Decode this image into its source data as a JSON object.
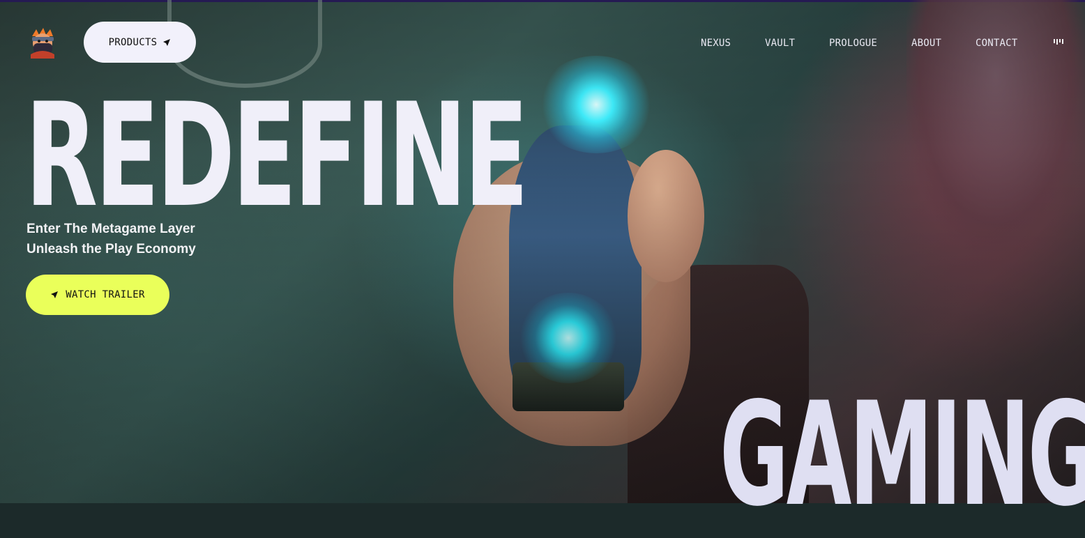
{
  "header": {
    "logo_name": "ninja-avatar-logo",
    "products_label": "PRODUCTS",
    "nav": [
      "NEXUS",
      "VAULT",
      "PROLOGUE",
      "ABOUT",
      "CONTACT"
    ]
  },
  "hero": {
    "headline_top": "REDEFINE",
    "headline_bottom": "GAMING",
    "tagline_line1": "Enter The Metagame Layer",
    "tagline_line2": "Unleash the Play Economy",
    "cta_label": "WATCH TRAILER"
  },
  "colors": {
    "cta_yellow": "#eaff5a",
    "pill_white": "#f2f1fb",
    "headline": "#f0eff9"
  }
}
